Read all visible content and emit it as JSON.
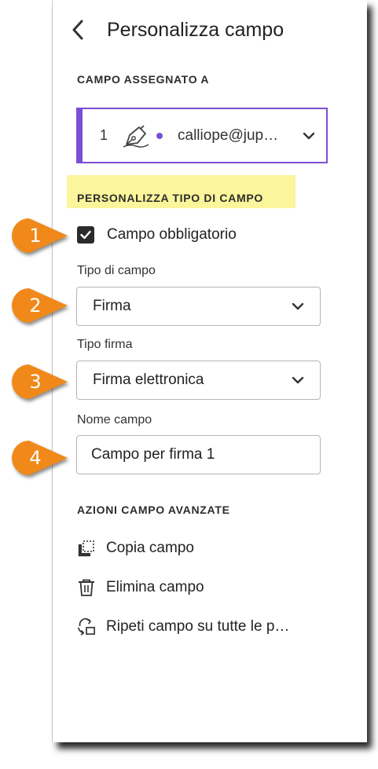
{
  "header": {
    "title": "Personalizza campo"
  },
  "assigned_section": {
    "label": "CAMPO ASSEGNATO A",
    "recipient": {
      "number": "1",
      "email": "calliope@jup…",
      "accent_color": "#7a4fd4"
    }
  },
  "customize_section": {
    "label": "PERSONALIZZA TIPO DI CAMPO",
    "highlight_color": "#fbf59b"
  },
  "required_checkbox": {
    "label": "Campo obbligatorio",
    "checked": true
  },
  "field_type": {
    "label": "Tipo di campo",
    "value": "Firma"
  },
  "signature_type": {
    "label": "Tipo firma",
    "value": "Firma elettronica"
  },
  "field_name": {
    "label": "Nome campo",
    "value": "Campo per firma 1"
  },
  "advanced_section": {
    "label": "AZIONI CAMPO AVANZATE",
    "actions": [
      {
        "label": "Copia campo",
        "icon": "copy-icon"
      },
      {
        "label": "Elimina campo",
        "icon": "trash-icon"
      },
      {
        "label": "Ripeti campo su tutte le p…",
        "icon": "repeat-icon"
      }
    ]
  },
  "callouts": [
    {
      "number": "1"
    },
    {
      "number": "2"
    },
    {
      "number": "3"
    },
    {
      "number": "4"
    }
  ],
  "colors": {
    "callout": "#f0891a",
    "accent": "#7a4fd4",
    "highlight": "#fbf59b"
  }
}
